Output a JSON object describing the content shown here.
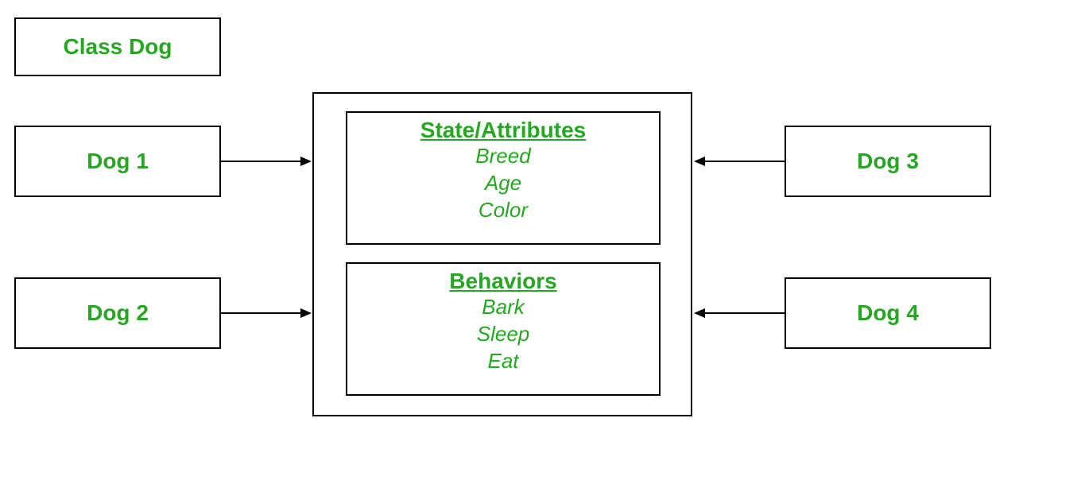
{
  "classBox": {
    "label": "Class Dog"
  },
  "instances": {
    "dog1": "Dog 1",
    "dog2": "Dog 2",
    "dog3": "Dog 3",
    "dog4": "Dog 4"
  },
  "center": {
    "attributes": {
      "title": "State/Attributes",
      "items": [
        "Breed",
        "Age",
        "Color"
      ]
    },
    "behaviors": {
      "title": "Behaviors",
      "items": [
        "Bark",
        "Sleep",
        "Eat"
      ]
    }
  }
}
